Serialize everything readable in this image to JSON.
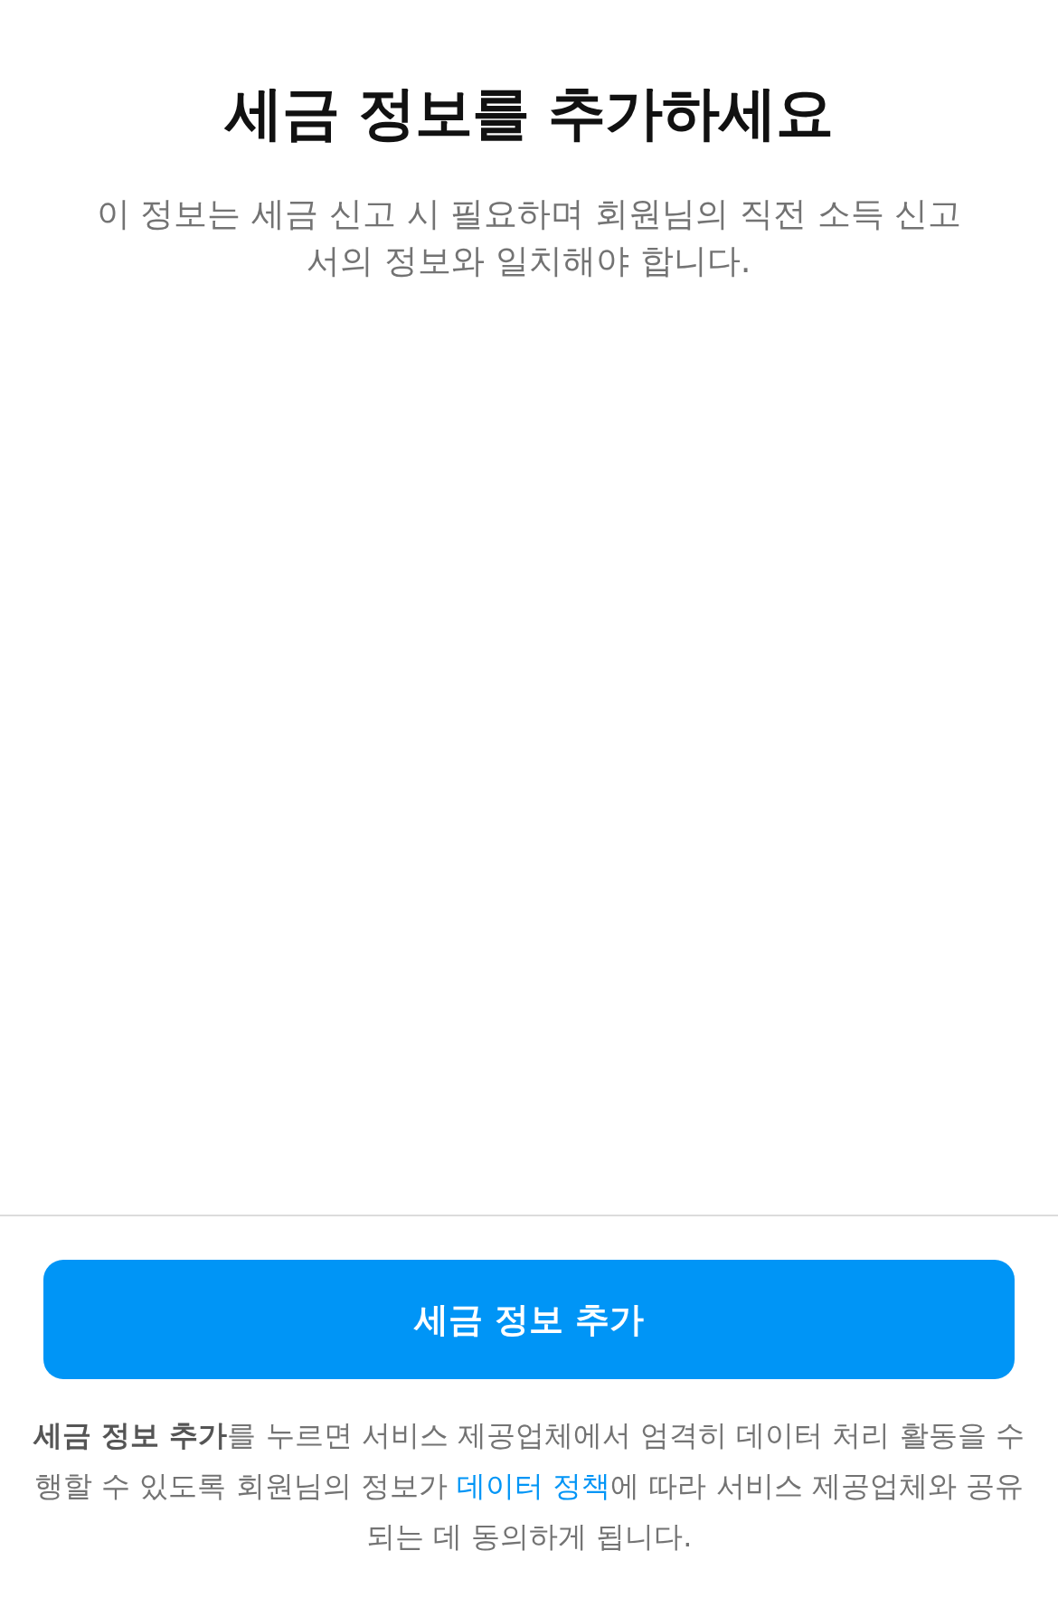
{
  "title": "세금 정보를 추가하세요",
  "subtitle": "이 정보는 세금 신고 시 필요하며 회원님의 직전 소득 신고서의 정보와 일치해야 합니다.",
  "button": {
    "label": "세금 정보 추가"
  },
  "consent": {
    "before": "**세금 정보 추가**를 누르면 서비스 제공업체에서 엄격히 데이터 처리 활동을 수행할 수 있도록 회원님의 정보가 ",
    "link": "데이터 정책",
    "after": "에 따라 서비스 제공업체와 공유되는 데 동의하게 됩니다."
  }
}
